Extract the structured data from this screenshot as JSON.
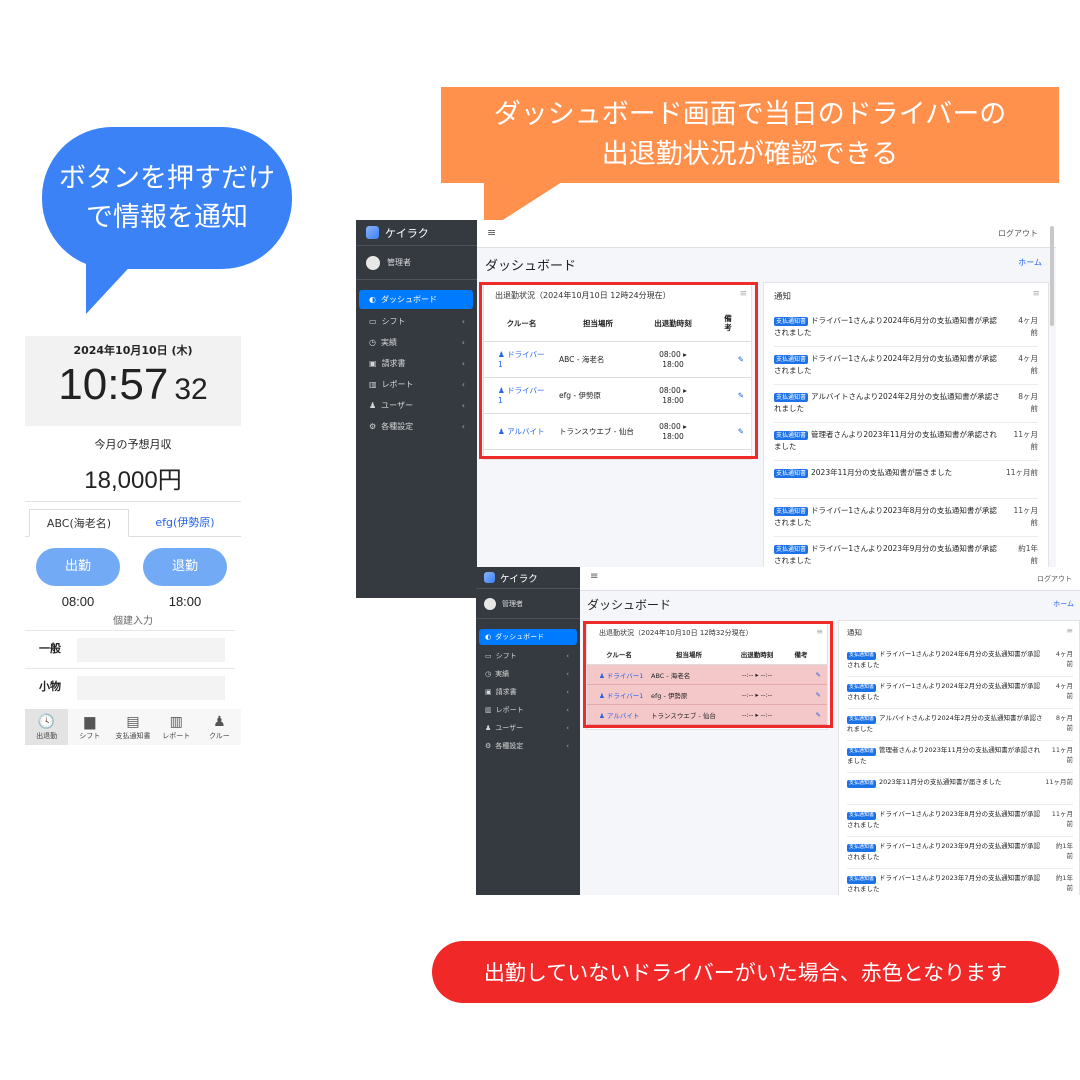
{
  "callouts": {
    "blue_line1": "ボタンを押すだけ",
    "blue_line2": "で情報を通知",
    "orange_line1": "ダッシュボード画面で当日のドライバーの",
    "orange_line2": "出退勤状況が確認できる",
    "red": "出勤していないドライバーがいた場合、赤色となります"
  },
  "phone": {
    "date": "2024年10月10日 (木)",
    "time_hm": "10:57",
    "time_s": "32",
    "income_label": "今月の予想月収",
    "income_value": "18,000円",
    "tabs": [
      "ABC(海老名)",
      "efg(伊勢原)"
    ],
    "clock_in": "出勤",
    "clock_out": "退勤",
    "start_time": "08:00",
    "end_time": "18:00",
    "manual_entry": "個建入力",
    "rows": [
      "一般",
      "小物"
    ],
    "nav": [
      "出退勤",
      "シフト",
      "支払通知書",
      "レポート",
      "クルー"
    ],
    "nav_icons": [
      "clock-icon",
      "truck-icon",
      "document-icon",
      "bar-chart-icon",
      "person-icon"
    ]
  },
  "dashboard_a": {
    "brand": "ケイラク",
    "user": "管理者",
    "menu": [
      "ダッシュボード",
      "シフト",
      "実績",
      "請求書",
      "レポート",
      "ユーザー",
      "各種設定"
    ],
    "menu_icons": [
      "dashboard-icon",
      "calendar-icon",
      "clock-icon",
      "money-icon",
      "bar-chart-icon",
      "user-icon",
      "gears-icon"
    ],
    "logout": "ログアウト",
    "title": "ダッシュボード",
    "home": "ホーム",
    "attendance_title": "出退勤状況（2024年10月10日 12時24分現在）",
    "columns": [
      "クルー名",
      "担当場所",
      "出退勤時刻",
      "備考"
    ],
    "rows": [
      {
        "crew_line1": "ドライバー",
        "crew_line2": "1",
        "place": "ABC - 海老名",
        "in": "08:00 ▸",
        "out": "18:00"
      },
      {
        "crew_line1": "ドライバー",
        "crew_line2": "1",
        "place": "efg - 伊勢原",
        "in": "08:00 ▸",
        "out": "18:00"
      },
      {
        "crew_line1": "アルバイト",
        "crew_line2": "",
        "place": "トランスウエブ - 仙台",
        "in": "08:00 ▸",
        "out": "18:00"
      }
    ],
    "notice_title": "通知",
    "badge": "支払通知書",
    "notices": [
      {
        "text": "ドライバー1さんより2024年6月分の支払通知書が承認されました",
        "t1": "4ヶ月",
        "t2": "前"
      },
      {
        "text": "ドライバー1さんより2024年2月分の支払通知書が承認されました",
        "t1": "4ヶ月",
        "t2": "前"
      },
      {
        "text": "アルバイトさんより2024年2月分の支払通知書が承認されました",
        "t1": "8ヶ月",
        "t2": "前"
      },
      {
        "text": "管理者さんより2023年11月分の支払通知書が承認されました",
        "t1": "11ヶ月",
        "t2": "前"
      },
      {
        "text": "2023年11月分の支払通知書が届きました",
        "t1": "11ヶ月前",
        "t2": ""
      },
      {
        "text": "ドライバー1さんより2023年8月分の支払通知書が承認されました",
        "t1": "11ヶ月",
        "t2": "前"
      },
      {
        "text": "ドライバー1さんより2023年9月分の支払通知書が承認されました",
        "t1": "約1年",
        "t2": "前"
      }
    ]
  },
  "dashboard_b": {
    "brand": "ケイラク",
    "user": "管理者",
    "menu": [
      "ダッシュボード",
      "シフト",
      "実績",
      "請求書",
      "レポート",
      "ユーザー",
      "各種設定"
    ],
    "logout": "ログアウト",
    "title": "ダッシュボード",
    "home": "ホーム",
    "attendance_title": "出退勤状況（2024年10月10日 12時32分現在）",
    "columns": [
      "クルー名",
      "担当場所",
      "出退勤時刻",
      "備考"
    ],
    "rows": [
      {
        "crew": "ドライバー1",
        "place": "ABC - 海老名",
        "times": "--:-- ▸ --:--"
      },
      {
        "crew": "ドライバー1",
        "place": "efg - 伊勢原",
        "times": "--:-- ▸ --:--"
      },
      {
        "crew": "アルバイト",
        "place": "トランスウエブ - 仙台",
        "times": "--:-- ▸ --:--"
      }
    ],
    "absent_row_color": "#f4c7c9",
    "notice_title": "通知",
    "badge": "支払通知書",
    "notices": [
      {
        "text": "ドライバー1さんより2024年6月分の支払通知書が承認されました",
        "t1": "4ヶ月",
        "t2": "前"
      },
      {
        "text": "ドライバー1さんより2024年2月分の支払通知書が承認されました",
        "t1": "4ヶ月",
        "t2": "前"
      },
      {
        "text": "アルバイトさんより2024年2月分の支払通知書が承認されました",
        "t1": "8ヶ月",
        "t2": "前"
      },
      {
        "text": "管理者さんより2023年11月分の支払通知書が承認されました",
        "t1": "11ヶ月",
        "t2": "前"
      },
      {
        "text": "2023年11月分の支払通知書が届きました",
        "t1": "11ヶ月前",
        "t2": ""
      },
      {
        "text": "ドライバー1さんより2023年8月分の支払通知書が承認されました",
        "t1": "11ヶ月",
        "t2": "前"
      },
      {
        "text": "ドライバー1さんより2023年9月分の支払通知書が承認されました",
        "t1": "約1年",
        "t2": "前"
      },
      {
        "text": "ドライバー1さんより2023年7月分の支払通知書が承認されました",
        "t1": "約1年",
        "t2": "前"
      }
    ]
  }
}
